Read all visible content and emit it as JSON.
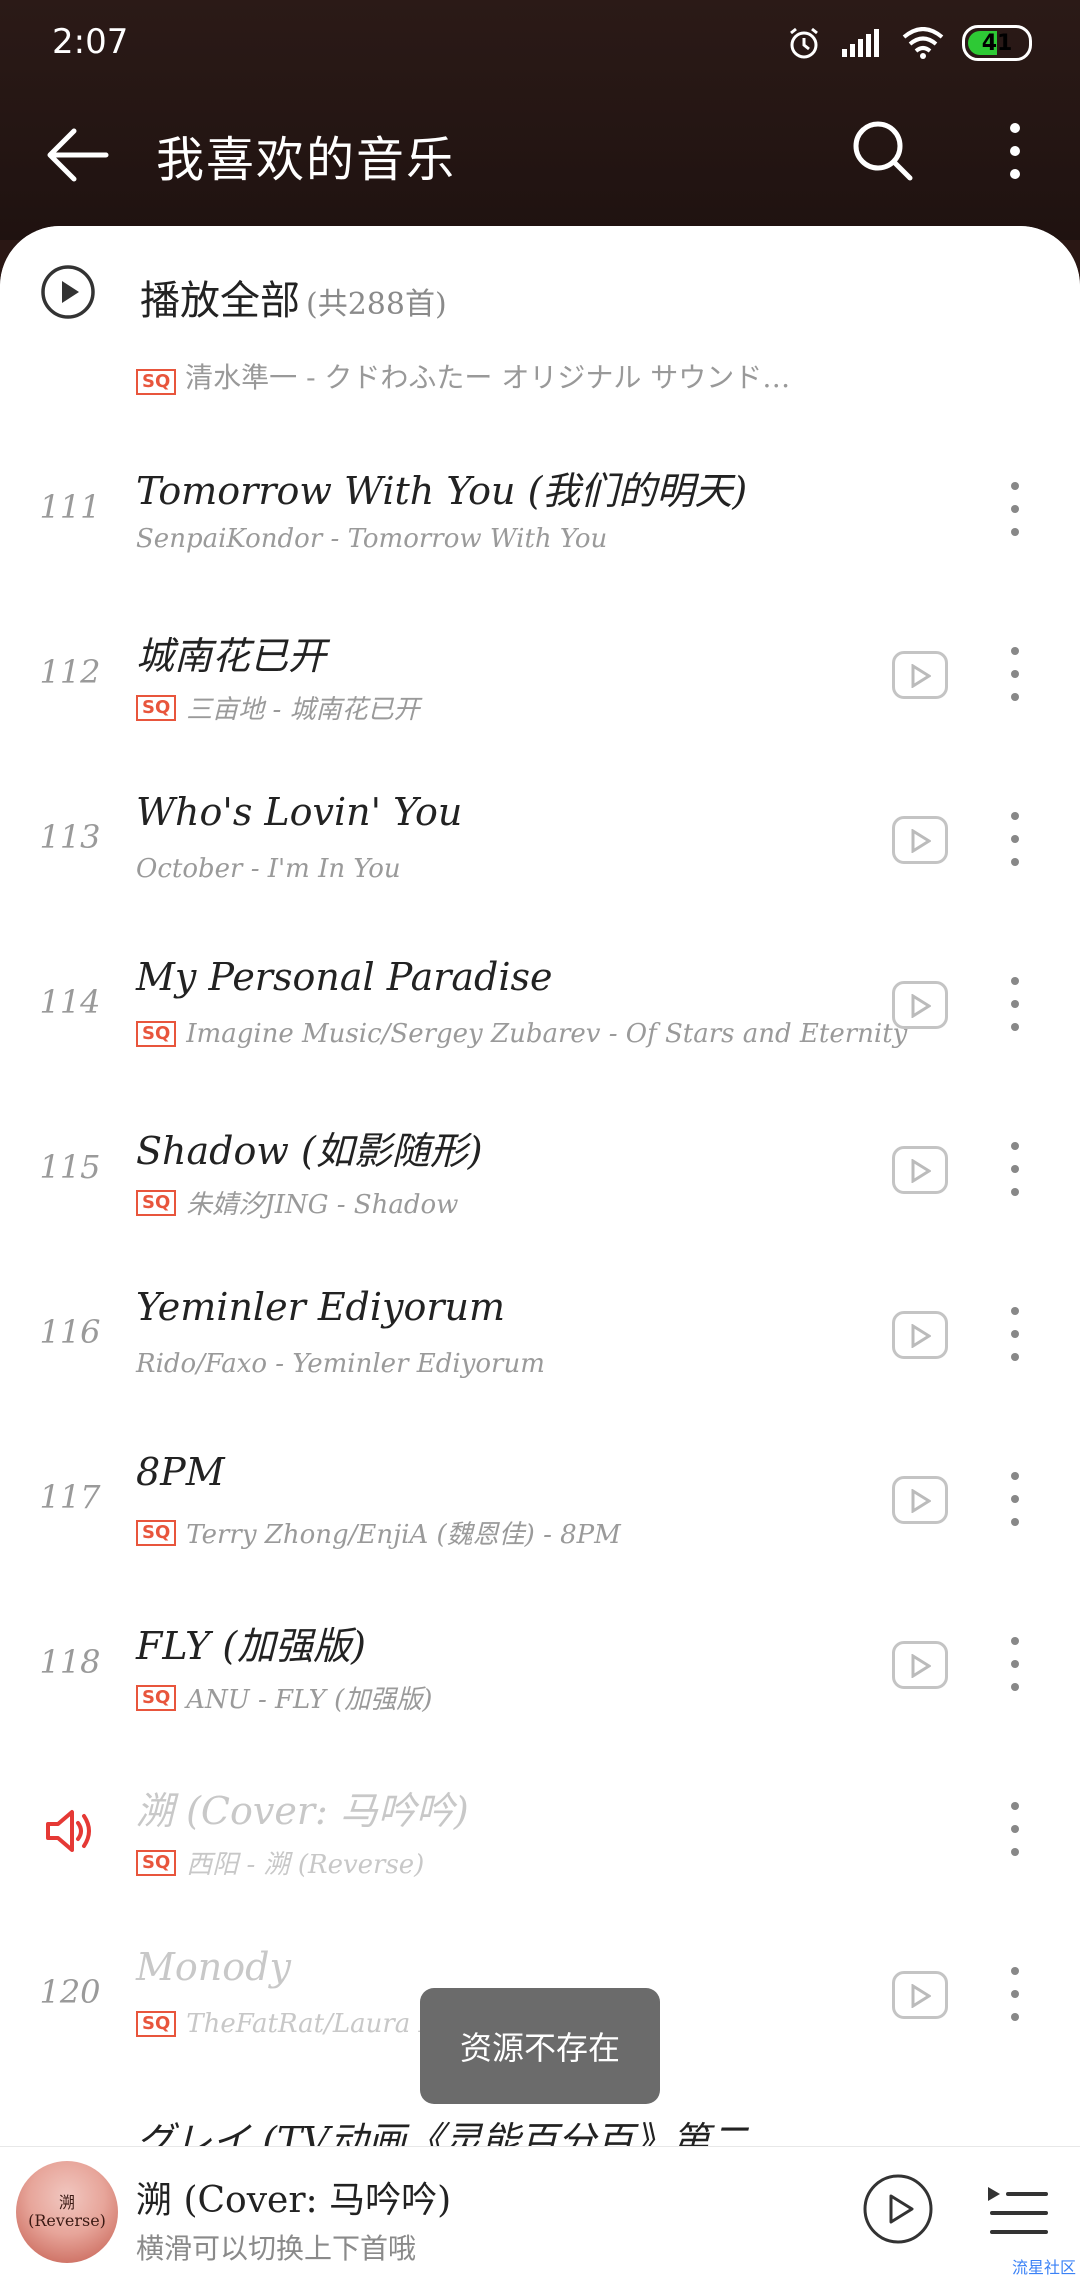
{
  "status_bar": {
    "time": "2:07",
    "battery": "41"
  },
  "header": {
    "title": "我喜欢的音乐"
  },
  "play_all": {
    "label": "播放全部",
    "count": "(共288首)"
  },
  "partial_top": {
    "subtitle": "清水準一 - クドわふたー オリジナル サウンド…"
  },
  "songs": [
    {
      "index": "111",
      "title": "Tomorrow With You (我们的明天)",
      "subtitle": "SenpaiKondor - Tomorrow With You",
      "sq": false,
      "mv": false
    },
    {
      "index": "112",
      "title": "城南花已开",
      "subtitle": "三亩地 - 城南花已开",
      "sq": true,
      "mv": true
    },
    {
      "index": "113",
      "title": "Who's Lovin' You",
      "subtitle": "October - I'm In You",
      "sq": false,
      "mv": true
    },
    {
      "index": "114",
      "title": "My Personal Paradise",
      "subtitle": "Imagine Music/Sergey Zubarev - Of Stars and Eternity",
      "sq": true,
      "mv": true
    },
    {
      "index": "115",
      "title": "Shadow (如影随形)",
      "subtitle": "朱婧汐JING - Shadow",
      "sq": true,
      "mv": true
    },
    {
      "index": "116",
      "title": "Yeminler Ediyorum",
      "subtitle": "Rido/Faxo - Yeminler Ediyorum",
      "sq": false,
      "mv": true
    },
    {
      "index": "117",
      "title": "8PM",
      "subtitle": "Terry Zhong/EnjiA (魏恩佳) - 8PM",
      "sq": true,
      "mv": true
    },
    {
      "index": "118",
      "title": "FLY (加强版)",
      "subtitle": "ANU - FLY (加强版)",
      "sq": true,
      "mv": true
    },
    {
      "index": "",
      "title": "溯 (Cover: 马吟吟)",
      "subtitle": "西阳 - 溯 (Reverse)",
      "sq": true,
      "mv": false,
      "playing": true
    },
    {
      "index": "120",
      "title": "Monody",
      "subtitle": "TheFatRat/Laura Brehm",
      "sq": true,
      "mv": true
    },
    {
      "index": "",
      "title": "グレイ (TV动画《灵能百分百》第二…",
      "subtitle": "",
      "sq": false,
      "mv": false
    }
  ],
  "toast": {
    "text": "资源不存在"
  },
  "player": {
    "art_text_1": "溯",
    "art_text_2": "(Reverse)",
    "title": "溯 (Cover: 马吟吟)",
    "subtitle": "横滑可以切换上下首哦"
  },
  "watermark": "流星社区"
}
